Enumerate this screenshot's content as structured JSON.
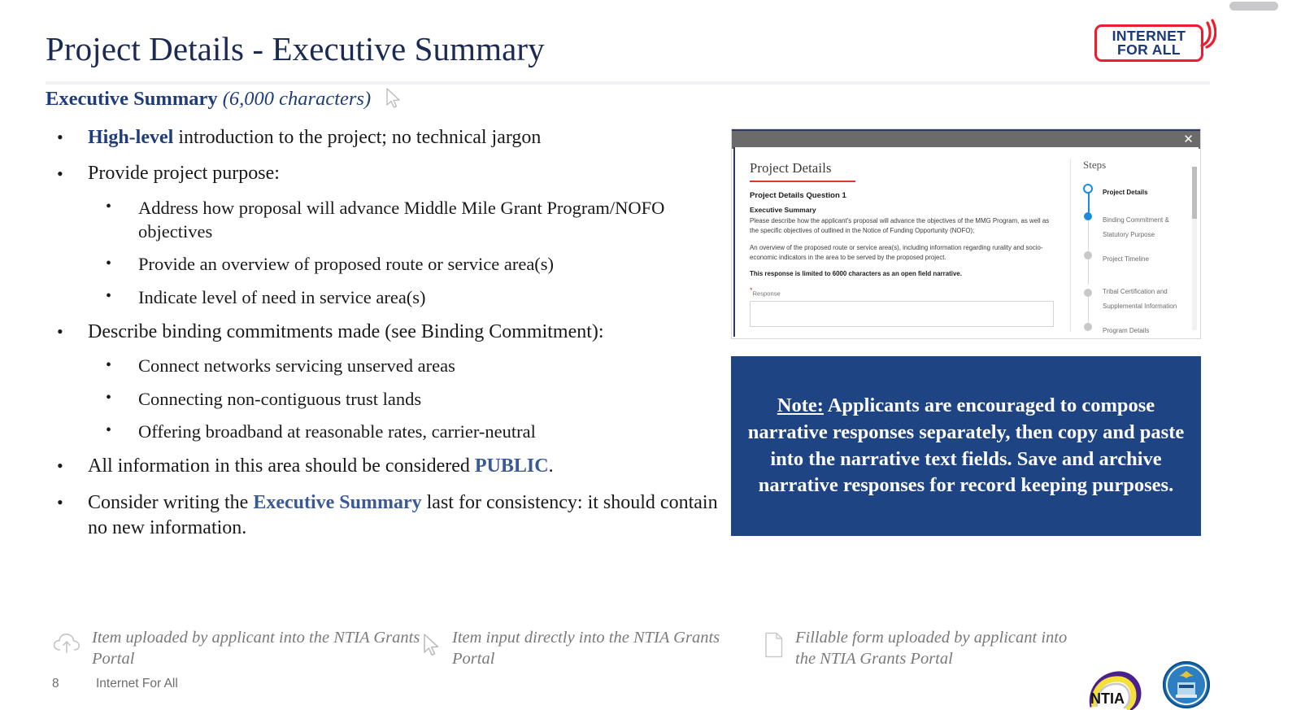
{
  "slide": {
    "title": "Project Details - Executive Summary",
    "subhead_bold": "Executive Summary",
    "subhead_italic": "(6,000 characters)"
  },
  "logo": {
    "line1": "INTERNET",
    "line2": "FOR ALL",
    "border_color": "#ed1c2e",
    "text_color": "#1b3a7a"
  },
  "bullets": [
    {
      "level": 1,
      "lead": "High-level",
      "text": " introduction to the project; no technical jargon"
    },
    {
      "level": 1,
      "text": "Provide project purpose:"
    },
    {
      "level": 2,
      "text": "Address how proposal will advance Middle Mile Grant Program/NOFO objectives"
    },
    {
      "level": 2,
      "text": "Provide an overview of proposed route or service area(s)"
    },
    {
      "level": 2,
      "text": "Indicate level of need in service area(s)"
    },
    {
      "level": 1,
      "text": "Describe binding commitments made (see Binding Commitment):"
    },
    {
      "level": 2,
      "text": "Connect networks servicing unserved areas"
    },
    {
      "level": 2,
      "text": "Connecting non-contiguous trust lands"
    },
    {
      "level": 2,
      "text": "Offering broadband at reasonable rates, carrier-neutral"
    },
    {
      "level": 1,
      "text": "All information in this area should be considered ",
      "emph": "PUBLIC",
      "tail": "."
    },
    {
      "level": 1,
      "text": "Consider writing the ",
      "emph": "Executive Summary",
      "tail": " last for consistency: it should contain no new information."
    }
  ],
  "bullet_glyph": "•",
  "screenshot": {
    "close_label": "✕",
    "page_title": "Project Details",
    "question_heading": "Project Details Question 1",
    "question_subheading": "Executive Summary",
    "paragraph_1": "Please describe how the applicant's proposal will advance the objectives of the MMG Program, as well as the specific objectives of outlined in the Notice of Funding Opportunity (NOFO);",
    "paragraph_2": "An overview of the proposed route or service area(s), including information regarding rurality and socio-economic indicators in the area to be served by the proposed project.",
    "paragraph_3": "This response is limited to 6000 characters as an open field narrative.",
    "response_label": "Response",
    "response_required_mark": "*",
    "response_value": "",
    "response_placeholder": "",
    "steps_heading": "Steps",
    "steps": [
      {
        "label": "Project Details",
        "state": "current"
      },
      {
        "label": "Binding Commitment & Statutory Purpose",
        "state": "done"
      },
      {
        "label": "Project Timeline",
        "state": "pending"
      },
      {
        "label": "Tribal Certification and Supplemental Information",
        "state": "pending"
      },
      {
        "label": "Program Details",
        "state": "pending"
      }
    ]
  },
  "note": {
    "prefix": "Note:",
    "body": " Applicants are encouraged to compose narrative responses separately, then copy and paste into the narrative text fields. Save and archive narrative responses for record keeping purposes.",
    "background_color": "#1f4484",
    "text_color": "#ffffff"
  },
  "legend": [
    {
      "icon": "cloud-upload-icon",
      "text": "Item uploaded by applicant into the NTIA Grants Portal"
    },
    {
      "icon": "cursor-arrow-icon",
      "text": "Item input directly into the NTIA Grants Portal"
    },
    {
      "icon": "document-icon",
      "text": "Fillable form uploaded by applicant into the NTIA Grants Portal"
    }
  ],
  "footer": {
    "page_number": "8",
    "label": "Internet For All"
  },
  "agency": {
    "ntia_label": "NTIA",
    "seal_label": "Department of Commerce"
  }
}
